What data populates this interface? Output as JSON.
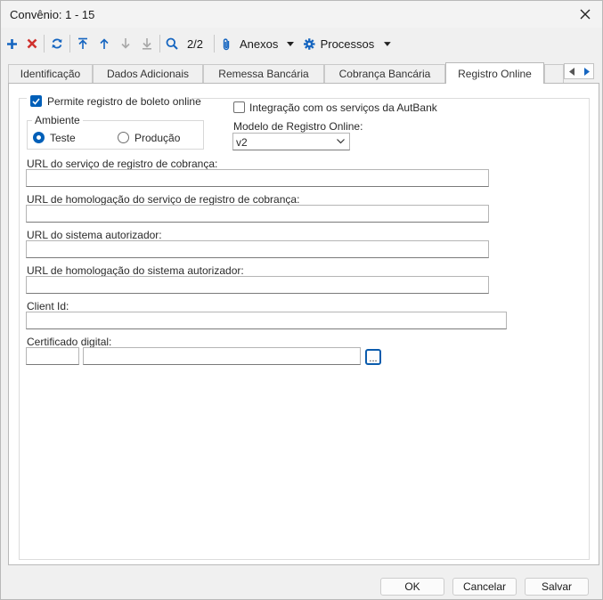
{
  "window": {
    "title": "Convênio: 1 - 15"
  },
  "toolbar": {
    "record_counter": "2/2",
    "anexos_label": "Anexos",
    "processos_label": "Processos"
  },
  "tabs": [
    {
      "label": "Identificação"
    },
    {
      "label": "Dados Adicionais"
    },
    {
      "label": "Remessa Bancária"
    },
    {
      "label": "Cobrança Bancária"
    },
    {
      "label": "Registro Online"
    }
  ],
  "form": {
    "permite_registro_label": "Permite registro de boleto online",
    "permite_registro_checked": true,
    "ambiente_label": "Ambiente",
    "ambiente_options": [
      "Teste",
      "Produção"
    ],
    "ambiente_selected": "Teste",
    "integracao_label": "Integração com os serviços da AutBank",
    "integracao_checked": false,
    "modelo_label": "Modelo de Registro Online:",
    "modelo_value": "v2",
    "url_registro_label": "URL do serviço de registro de cobrança:",
    "url_registro_value": "",
    "url_homolog_registro_label": "URL de homologação do serviço de registro de cobrança:",
    "url_homolog_registro_value": "",
    "url_autorizador_label": "URL do sistema autorizador:",
    "url_autorizador_value": "",
    "url_homolog_autorizador_label": "URL de homologação do sistema autorizador:",
    "url_homolog_autorizador_value": "",
    "client_id_label": "Client Id:",
    "client_id_value": "",
    "certificado_label": "Certificado digital:",
    "certificado_code": "",
    "certificado_name": "",
    "browse_label": "..."
  },
  "buttons": {
    "ok": "OK",
    "cancel": "Cancelar",
    "save": "Salvar"
  },
  "colors": {
    "accent": "#005fb8",
    "delete": "#d0312d",
    "toolbar_icon": "#1565c0"
  }
}
